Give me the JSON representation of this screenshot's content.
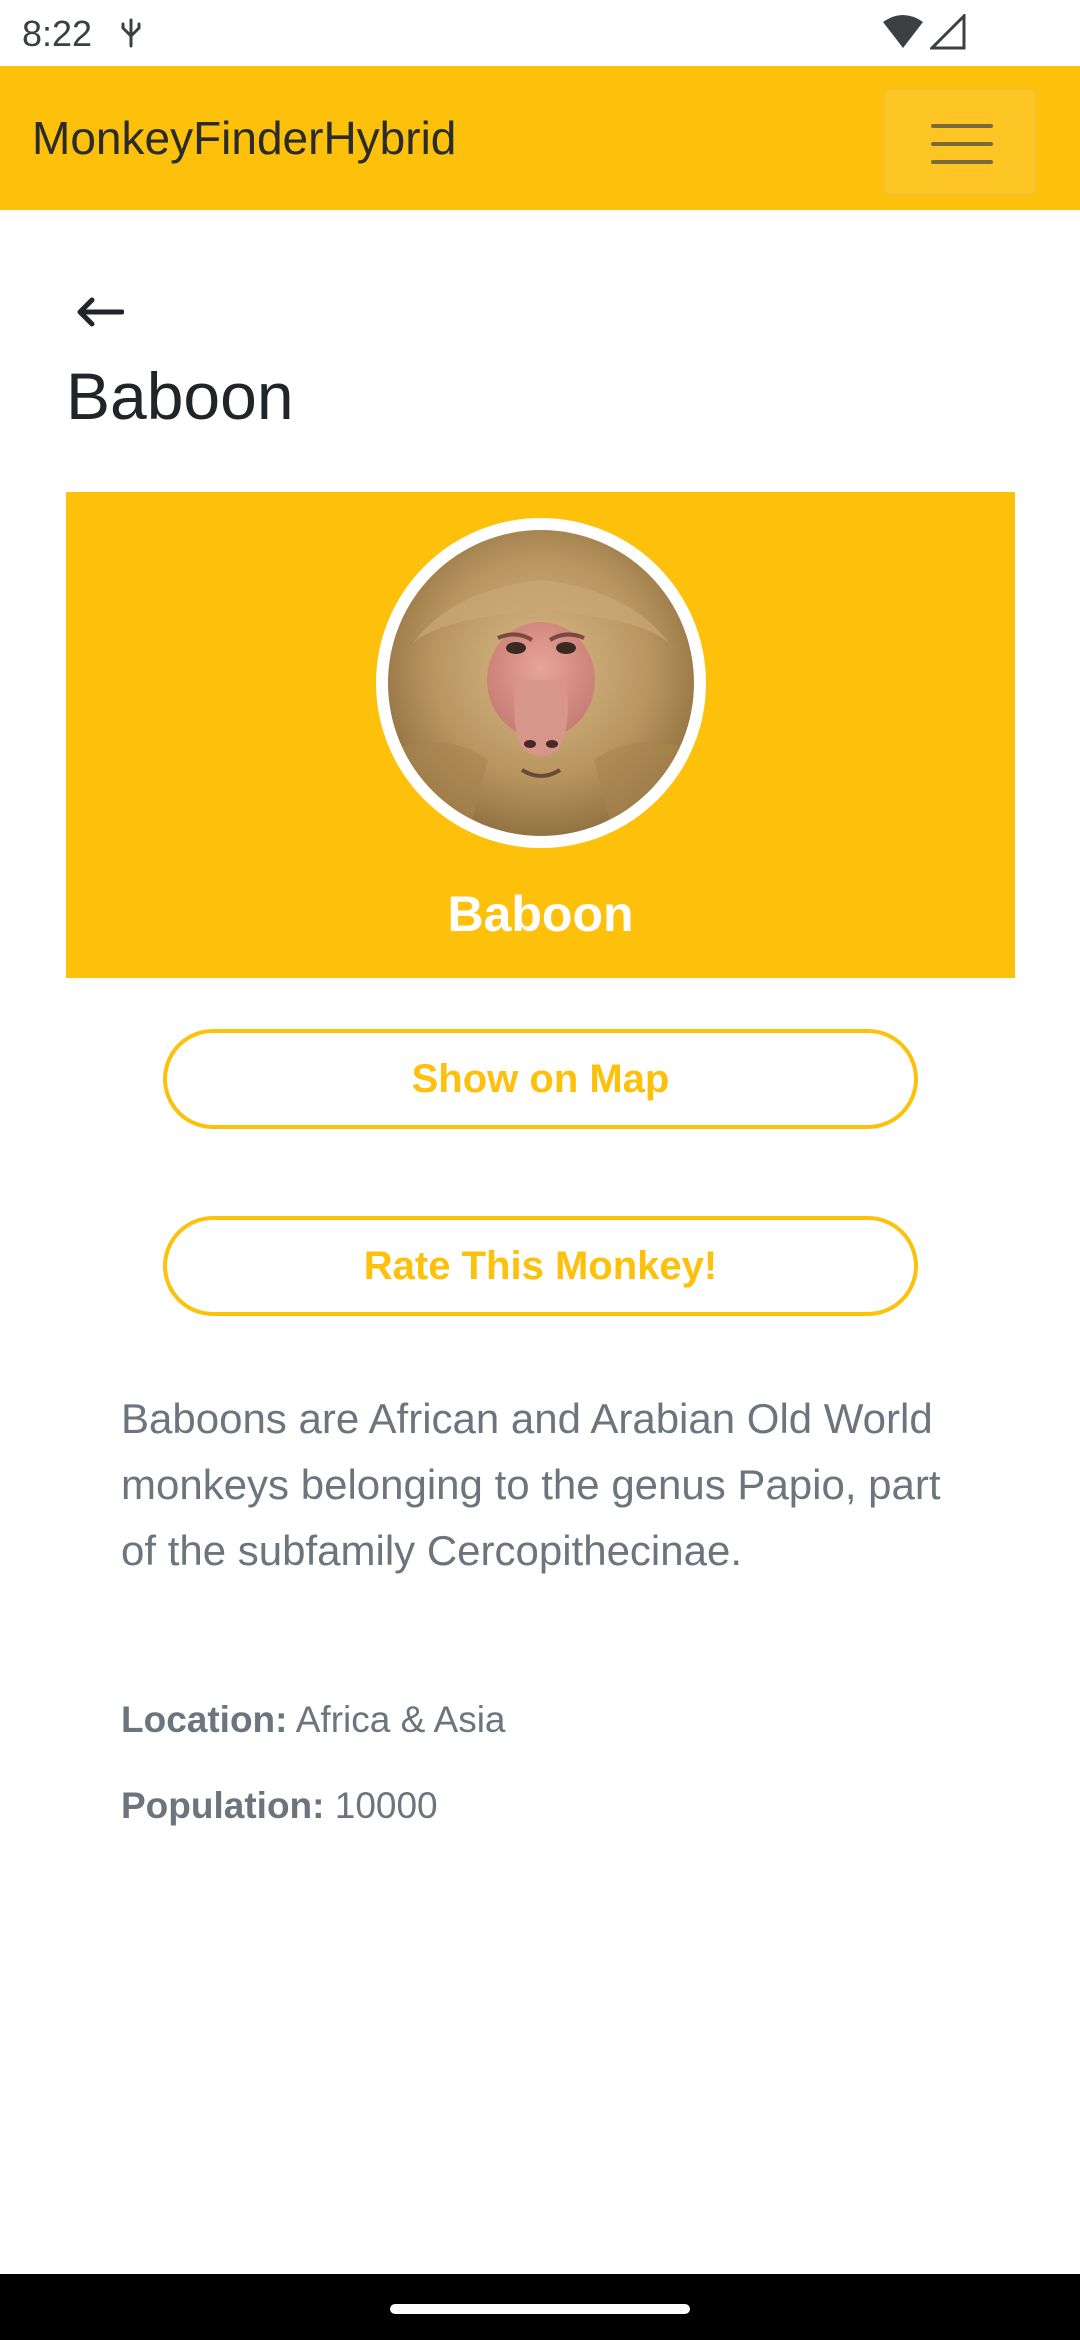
{
  "status_bar": {
    "time": "8:22",
    "icons": [
      "usb-icon",
      "wifi-icon",
      "signal-icon"
    ]
  },
  "app_bar": {
    "title": "MonkeyFinderHybrid",
    "menu_icon": "hamburger-menu-icon",
    "color": "#fdc10c"
  },
  "page": {
    "back_icon": "back-arrow-icon",
    "title": "Baboon"
  },
  "hero": {
    "name": "Baboon",
    "image": "baboon-photo"
  },
  "actions": {
    "show_on_map": "Show on Map",
    "rate": "Rate This Monkey!"
  },
  "details": {
    "description": "Baboons are African and Arabian Old World monkeys belonging to the genus Papio, part of the subfamily Cercopithecinae.",
    "location_label": "Location:",
    "location_value": "Africa & Asia",
    "population_label": "Population:",
    "population_value": "10000"
  },
  "colors": {
    "accent": "#fdc10c",
    "text_muted": "#6c757d",
    "text_dark": "#212529"
  }
}
